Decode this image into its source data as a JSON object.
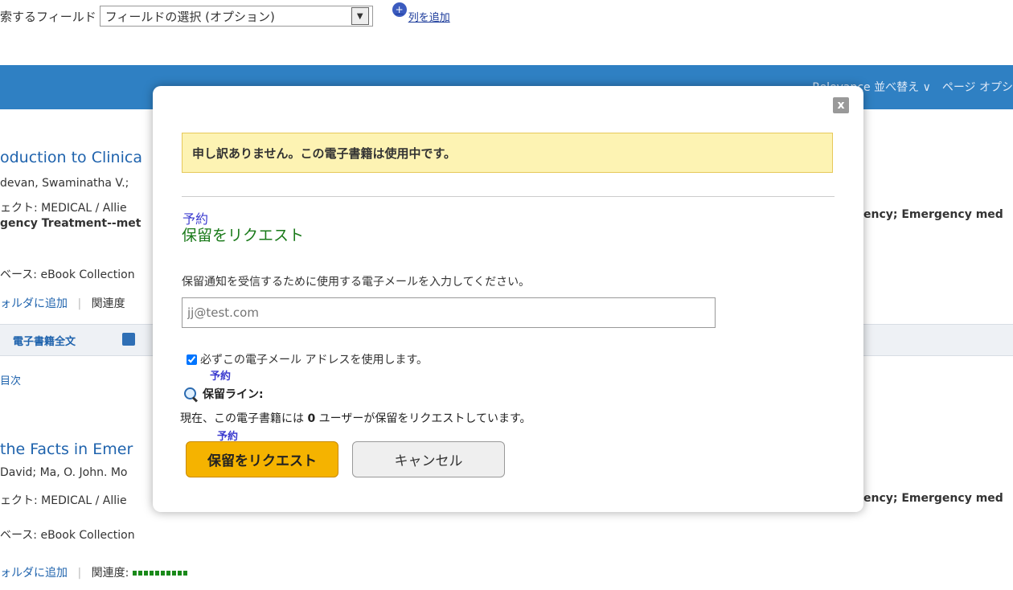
{
  "background": {
    "search_field_label": "索するフィールド",
    "search_field_select": "フィールドの選択 (オプション)",
    "add_column_link": "列を追加",
    "sort_bar_text": "Relevance 並べ替え ∨　ページ オプシ",
    "results": [
      {
        "title": "oduction to Clinica",
        "authors": "devan, Swaminatha V.;",
        "subject": "ェクト: MEDICAL / Allie",
        "subject2": "gency Treatment--met",
        "subject_right": "ency; Emergency med",
        "database": "ベース: eBook Collection",
        "folder_link": "ォルダに追加",
        "relevance": "関連度",
        "fulltext": "電子書籍全文",
        "toc": "目次"
      },
      {
        "title": "the Facts in Emer",
        "authors": "David; Ma, O. John. Mo",
        "subject": "ェクト: MEDICAL / Allie",
        "subject_right": "ency; Emergency med",
        "database": "ベース: eBook Collection",
        "folder_link": "ォルダに追加",
        "relevance": "関連度:"
      }
    ]
  },
  "modal": {
    "close_label": "x",
    "alert": "申し訳ありません。この電子書籍は使用中です。",
    "hold_small": "予約",
    "hold_title": "保留をリクエスト",
    "instruction": "保留通知を受信するために使用する電子メールを入力してください。",
    "email_placeholder": "jj@test.com",
    "always_use_label": "必ずこの電子メール アドレスを使用します。",
    "queue_small": "予約",
    "queue_label": "保留ライン:",
    "queue_info_prefix": "現在、この電子書籍には",
    "queue_count": "0",
    "queue_info_suffix": "ユーザーが保留をリクエストしています。",
    "request_small": "予約",
    "request_button": "保留をリクエスト",
    "cancel_button": "キャンセル"
  },
  "colors": {
    "bluebar": "#2f80c3",
    "alert_bg": "#fdf3b3",
    "request_button": "#f5b300",
    "hold_title": "#1a7a1a",
    "small_hold": "#3b3bcf"
  }
}
